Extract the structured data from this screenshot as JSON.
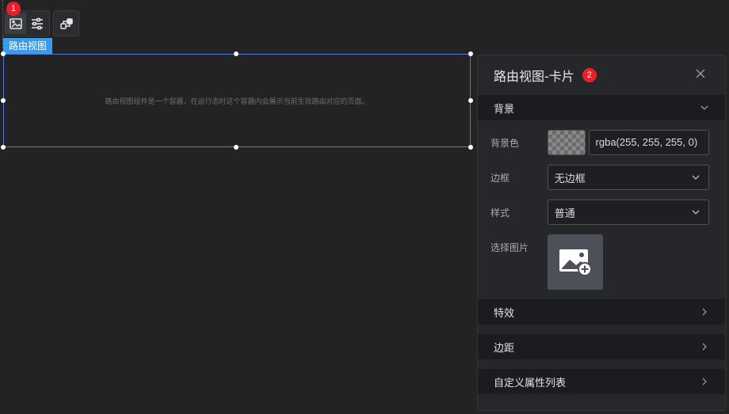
{
  "toolbar": {
    "badge": "1",
    "icons": [
      "image-icon",
      "sliders-icon",
      "link-shapes-icon"
    ]
  },
  "component": {
    "tag": "路由视图",
    "placeholder": "路由视图组件是一个容器，在运行态时这个容器内会展示当前生效路由对应的页面。"
  },
  "panel": {
    "title": "路由视图-卡片",
    "badge": "2",
    "sections": {
      "background": "背景",
      "effects": "特效",
      "margin": "边距",
      "custom_props": "自定义属性列表"
    },
    "fields": {
      "bg_color_label": "背景色",
      "bg_color_value": "rgba(255, 255, 255, 0)",
      "border_label": "边框",
      "border_value": "无边框",
      "style_label": "样式",
      "style_value": "普通",
      "image_label": "选择图片"
    }
  },
  "colors": {
    "accent": "#3c9be8",
    "badge": "#e8202a",
    "selection": "#4c7dd8"
  }
}
